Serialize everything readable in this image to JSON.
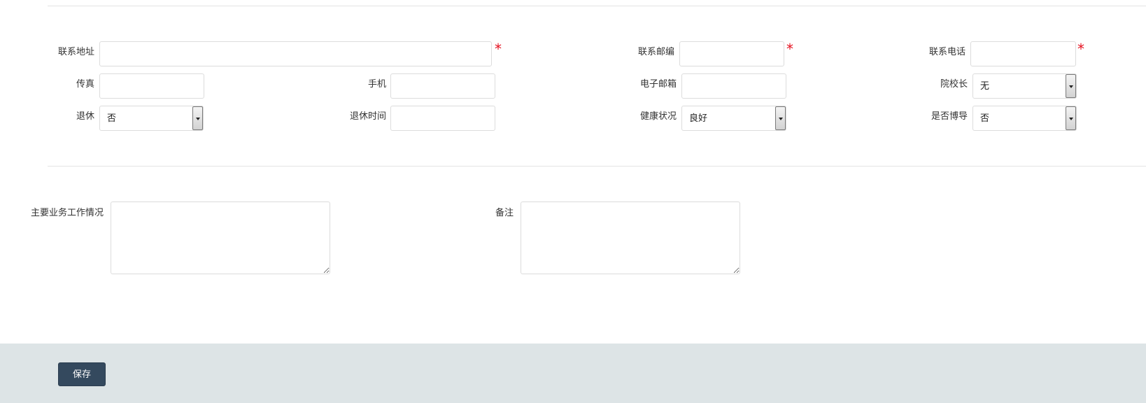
{
  "contact": {
    "address_label": "联系地址",
    "postcode_label": "联系邮编",
    "phone_label": "联系电话",
    "fax_label": "传真",
    "mobile_label": "手机",
    "email_label": "电子邮箱",
    "president_label": "院校长",
    "president_value": "无",
    "retired_label": "退休",
    "retired_value": "否",
    "retire_time_label": "退休时间",
    "health_label": "健康状况",
    "health_value": "良好",
    "phd_supervisor_label": "是否博导",
    "phd_supervisor_value": "否",
    "required_mark": "*"
  },
  "details": {
    "main_work_label": "主要业务工作情况",
    "remark_label": "备注"
  },
  "footer": {
    "save_label": "保存"
  }
}
